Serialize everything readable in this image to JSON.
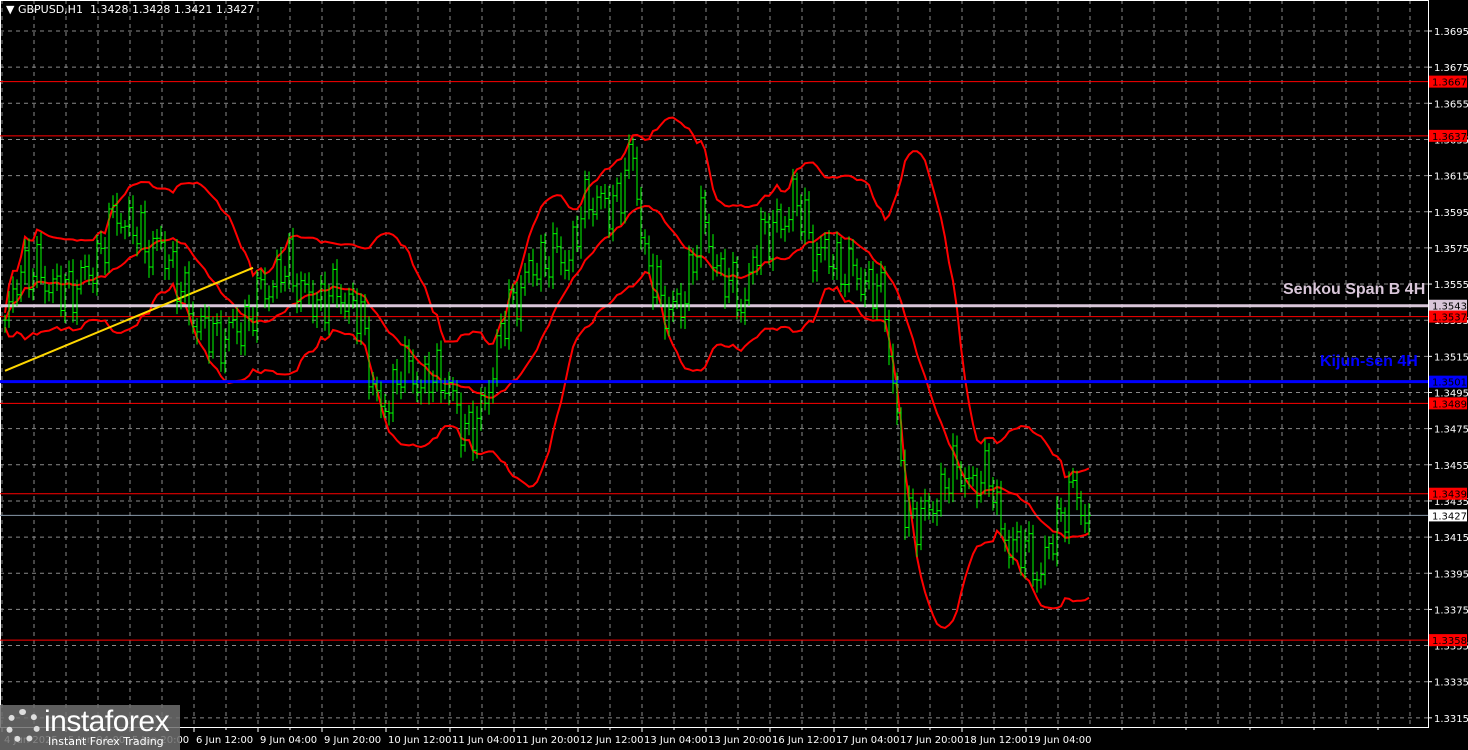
{
  "header": {
    "symbol": "GBPUSD,H1",
    "ohlc": "1.3428 1.3428 1.3421 1.3427"
  },
  "logo": {
    "brand": "instaforex",
    "tagline": "Instant Forex Trading"
  },
  "annotations": {
    "senkou": "Senkou Span B 4H",
    "kijun": "Kijun-sen 4H"
  },
  "colors": {
    "candle": "#00ff00",
    "level": "#ff0000",
    "kijun": "#0000ff",
    "senkou": "#d9c6d9",
    "trend": "#ffd700",
    "grid": "#8a8a8a"
  },
  "chart_data": {
    "type": "candlestick",
    "title": "GBPUSD,H1",
    "ylim": [
      1.3305,
      1.3712
    ],
    "yticks": [
      "1.3695",
      "1.3675",
      "1.3655",
      "1.3635",
      "1.3615",
      "1.3595",
      "1.3575",
      "1.3555",
      "1.3535",
      "1.3515",
      "1.3495",
      "1.3475",
      "1.3455",
      "1.3435",
      "1.3415",
      "1.3395",
      "1.3375",
      "1.3355",
      "1.3335",
      "1.3315"
    ],
    "xticks": [
      "4 Jun 2025",
      "5 Jun 04:00",
      "5 Jun 20:00",
      "6 Jun 12:00",
      "9 Jun 04:00",
      "9 Jun 20:00",
      "10 Jun 12:00",
      "11 Jun 04:00",
      "11 Jun 20:00",
      "12 Jun 12:00",
      "13 Jun 04:00",
      "13 Jun 20:00",
      "16 Jun 12:00",
      "17 Jun 04:00",
      "17 Jun 20:00",
      "18 Jun 12:00",
      "19 Jun 04:00"
    ],
    "bar_hours": 1,
    "close_path": [
      [
        0,
        1.353
      ],
      [
        4,
        1.3565
      ],
      [
        9,
        1.356
      ],
      [
        14,
        1.355
      ],
      [
        21,
        1.356
      ],
      [
        28,
        1.3595
      ],
      [
        34,
        1.358
      ],
      [
        41,
        1.357
      ],
      [
        46,
        1.354
      ],
      [
        52,
        1.3525
      ],
      [
        59,
        1.353
      ],
      [
        64,
        1.355
      ],
      [
        71,
        1.3565
      ],
      [
        76,
        1.3545
      ],
      [
        84,
        1.355
      ],
      [
        89,
        1.3535
      ],
      [
        94,
        1.348
      ],
      [
        99,
        1.351
      ],
      [
        104,
        1.35
      ],
      [
        110,
        1.3505
      ],
      [
        114,
        1.3475
      ],
      [
        119,
        1.348
      ],
      [
        124,
        1.353
      ],
      [
        129,
        1.3555
      ],
      [
        135,
        1.357
      ],
      [
        141,
        1.357
      ],
      [
        146,
        1.3605
      ],
      [
        151,
        1.3595
      ],
      [
        157,
        1.3625
      ],
      [
        160,
        1.357
      ],
      [
        164,
        1.3545
      ],
      [
        169,
        1.354
      ],
      [
        174,
        1.359
      ],
      [
        179,
        1.356
      ],
      [
        185,
        1.3545
      ],
      [
        189,
        1.3585
      ],
      [
        194,
        1.3585
      ],
      [
        197,
        1.3605
      ],
      [
        202,
        1.3575
      ],
      [
        209,
        1.3565
      ],
      [
        216,
        1.3555
      ],
      [
        220,
        1.3545
      ],
      [
        222,
        1.35
      ],
      [
        225,
        1.343
      ],
      [
        230,
        1.3425
      ],
      [
        235,
        1.3445
      ],
      [
        239,
        1.3455
      ],
      [
        242,
        1.344
      ],
      [
        246,
        1.3455
      ],
      [
        249,
        1.3415
      ],
      [
        254,
        1.341
      ],
      [
        259,
        1.3395
      ],
      [
        262,
        1.3415
      ],
      [
        266,
        1.344
      ],
      [
        271,
        1.3427
      ]
    ],
    "levels": [
      {
        "price": "1.3667",
        "kind": "resistance"
      },
      {
        "price": "1.3637",
        "kind": "resistance"
      },
      {
        "price": "1.3543",
        "kind": "senkou"
      },
      {
        "price": "1.3537",
        "kind": "resistance"
      },
      {
        "price": "1.3501",
        "kind": "kijun"
      },
      {
        "price": "1.3489",
        "kind": "support"
      },
      {
        "price": "1.3439",
        "kind": "support"
      },
      {
        "price": "1.3427",
        "kind": "current"
      },
      {
        "price": "1.3358",
        "kind": "support"
      }
    ],
    "trendline": [
      [
        0,
        1.3507
      ],
      [
        62,
        1.3564
      ]
    ],
    "indicator": "Bollinger-style bands (red)"
  }
}
